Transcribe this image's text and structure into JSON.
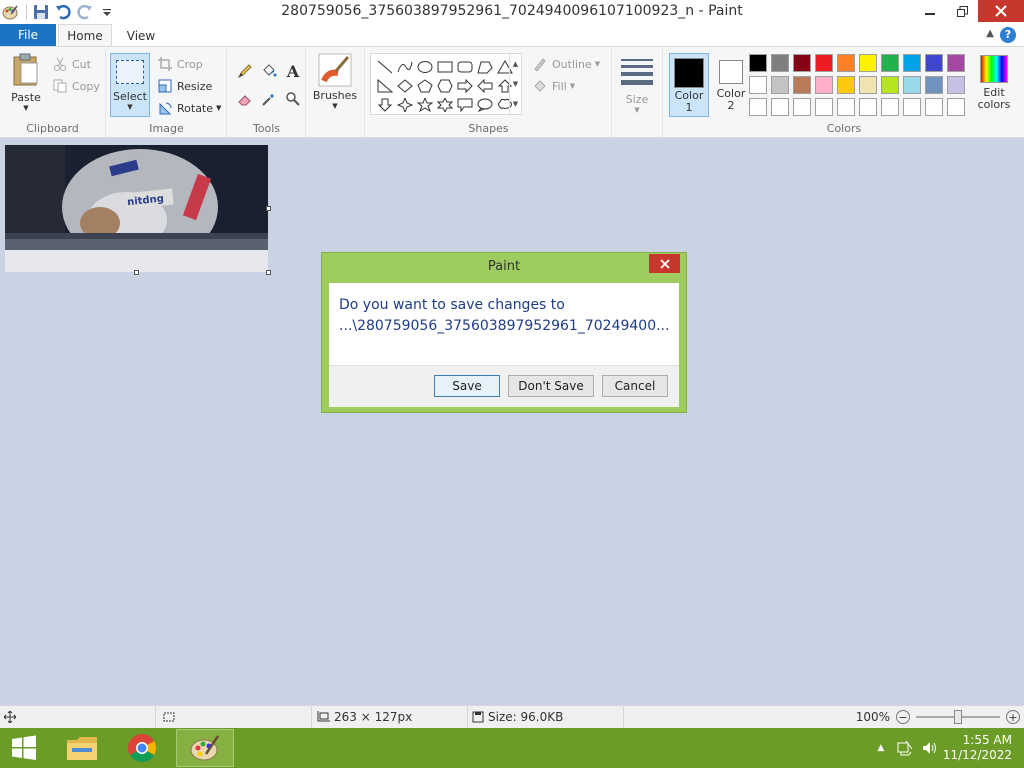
{
  "window": {
    "title": "280759056_375603897952961_7024940096107100923_n - Paint"
  },
  "tabs": {
    "file": "File",
    "home": "Home",
    "view": "View"
  },
  "clipboard": {
    "paste": "Paste",
    "cut": "Cut",
    "copy": "Copy",
    "label": "Clipboard"
  },
  "image_group": {
    "select": "Select",
    "crop": "Crop",
    "resize": "Resize",
    "rotate": "Rotate",
    "label": "Image"
  },
  "tools": {
    "label": "Tools"
  },
  "brushes": {
    "label": "Brushes"
  },
  "shapes": {
    "outline": "Outline",
    "fill": "Fill",
    "label": "Shapes"
  },
  "size": {
    "label": "Size"
  },
  "colors": {
    "color1_label": "Color",
    "color1_num": "1",
    "color2_label": "Color",
    "color2_num": "2",
    "edit1": "Edit",
    "edit2": "colors",
    "label": "Colors",
    "color1": "#000000",
    "color2": "#ffffff",
    "palette": [
      "#000000",
      "#7f7f7f",
      "#880015",
      "#ed1c24",
      "#ff7f27",
      "#fff200",
      "#22b14c",
      "#00a2e8",
      "#3f48cc",
      "#a349a4",
      "#ffffff",
      "#c3c3c3",
      "#b97a57",
      "#ffaec9",
      "#ffc90e",
      "#efe4b0",
      "#b5e61d",
      "#99d9ea",
      "#7092be",
      "#c8bfe7",
      "#ffffff",
      "#ffffff",
      "#ffffff",
      "#ffffff",
      "#ffffff",
      "#ffffff",
      "#ffffff",
      "#ffffff",
      "#ffffff",
      "#ffffff"
    ]
  },
  "dialog": {
    "title": "Paint",
    "line1": "Do you want to save changes to",
    "line2": "...\\280759056_375603897952961_70249400...",
    "save": "Save",
    "dont_save": "Don't Save",
    "cancel": "Cancel"
  },
  "status": {
    "dimensions": "263 × 127px",
    "size": "Size: 96.0KB",
    "zoom": "100%"
  },
  "taskbar": {
    "time": "1:55 AM",
    "date": "11/12/2022"
  }
}
